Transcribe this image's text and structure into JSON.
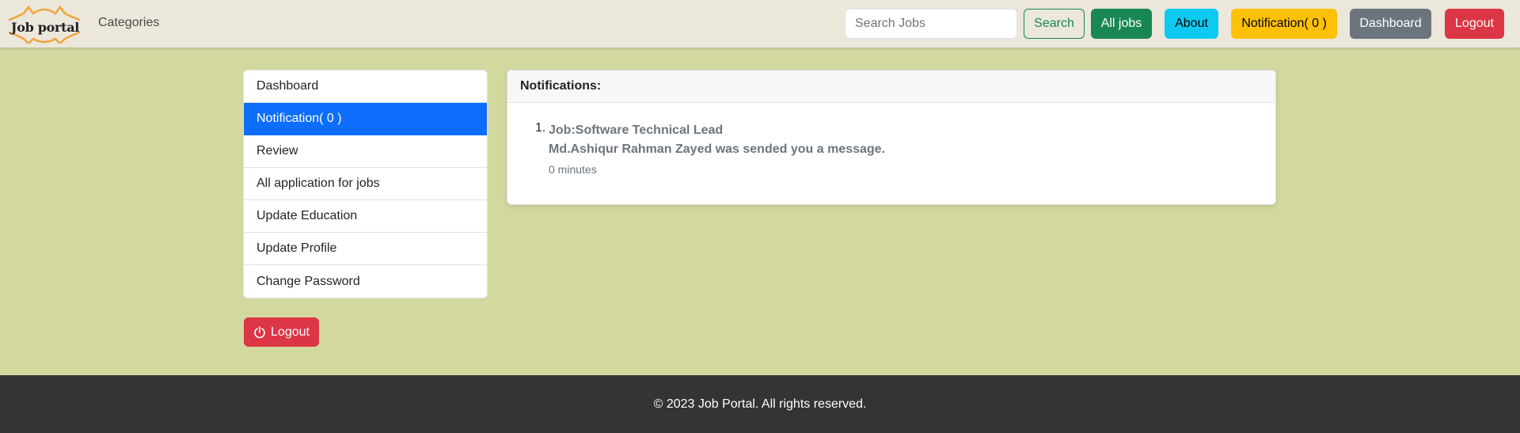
{
  "navbar": {
    "brand": "Job portal",
    "categories_label": "Categories",
    "search_placeholder": "Search Jobs",
    "search_button": "Search",
    "all_jobs_button": "All jobs",
    "about_button": "About",
    "notification_button": "Notification( 0 )",
    "dashboard_button": "Dashboard",
    "logout_button": "Logout"
  },
  "sidebar": {
    "items": [
      {
        "label": "Dashboard",
        "active": false
      },
      {
        "label": "Notification( 0 )",
        "active": true
      },
      {
        "label": "Review",
        "active": false
      },
      {
        "label": "All application for jobs",
        "active": false
      },
      {
        "label": "Update Education",
        "active": false
      },
      {
        "label": "Update Profile",
        "active": false
      },
      {
        "label": "Change Password",
        "active": false
      }
    ],
    "logout_label": "Logout",
    "logout_icon": "power-icon"
  },
  "notifications": {
    "header": "Notifications:",
    "items": [
      {
        "number": "1.",
        "job": "Job:Software Technical Lead",
        "message": "Md.Ashiqur Rahman Zayed was sended you a message.",
        "time": "0 minutes"
      }
    ]
  },
  "footer": {
    "text": "© 2023 Job Portal. All rights reserved."
  },
  "colors": {
    "page_background": "#d3d89f",
    "navbar_background": "#ebe7db",
    "active_item": "#0d6efd",
    "success": "#198754",
    "info": "#0dcaf0",
    "warning": "#ffc107",
    "secondary": "#6c757d",
    "danger": "#dc3545",
    "footer_background": "#343434"
  }
}
